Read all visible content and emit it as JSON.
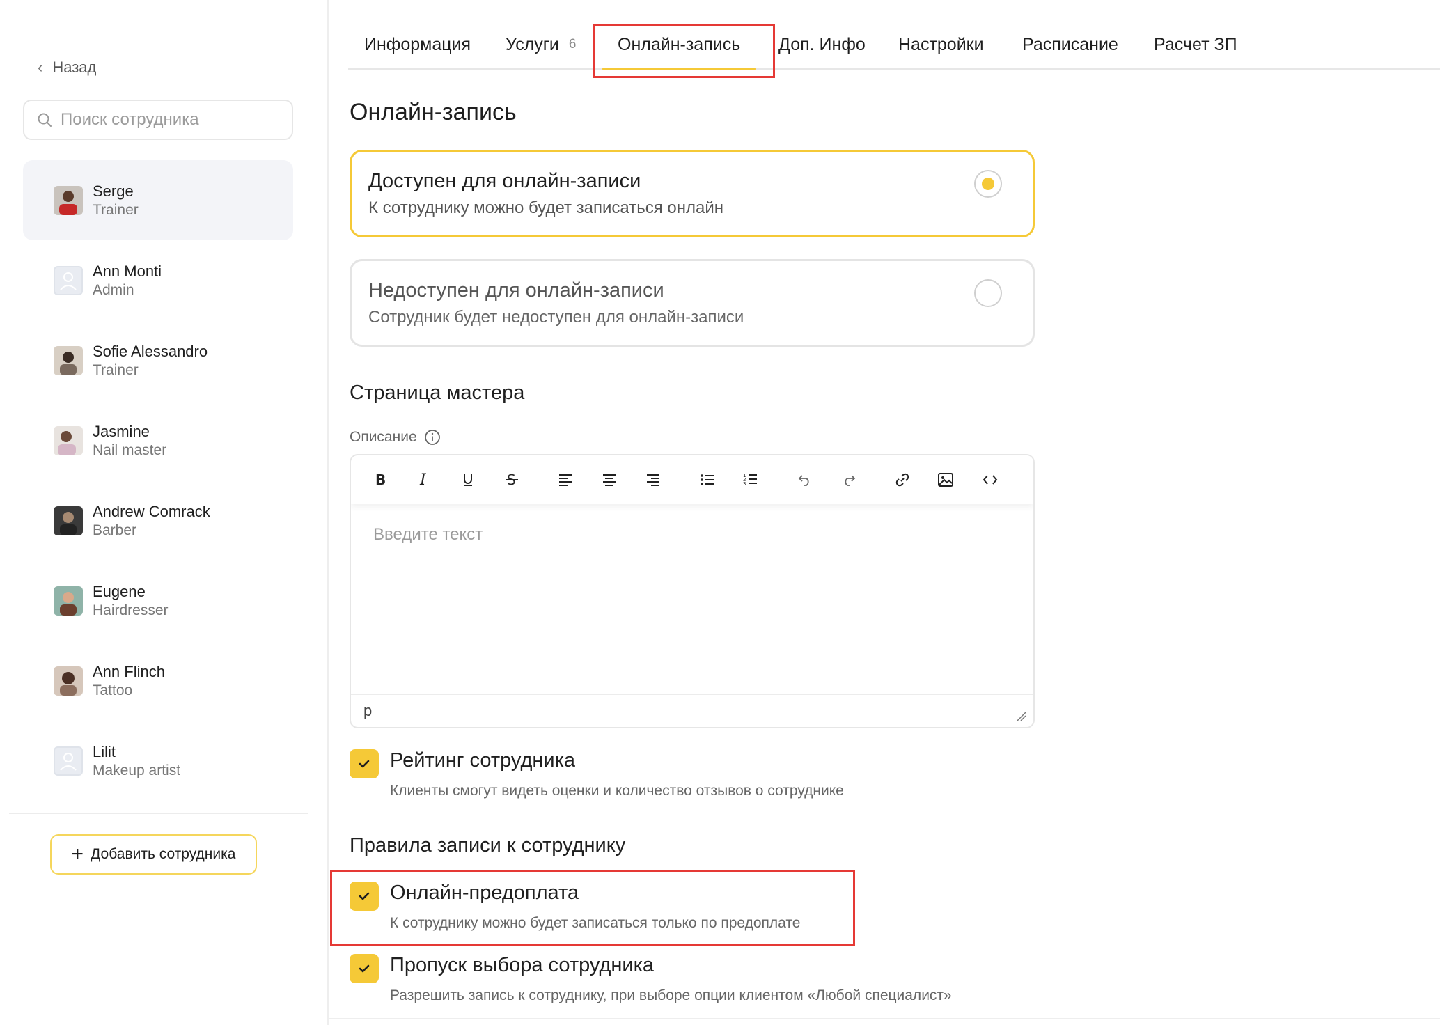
{
  "sidebar": {
    "back_label": "Назад",
    "search_placeholder": "Поиск сотрудника",
    "employees": [
      {
        "name": "Serge",
        "role": "Trainer",
        "avatar": "photo",
        "active": true
      },
      {
        "name": "Ann Monti",
        "role": "Admin",
        "avatar": "placeholder",
        "active": false
      },
      {
        "name": "Sofie Alessandro",
        "role": "Trainer",
        "avatar": "photo",
        "active": false
      },
      {
        "name": "Jasmine",
        "role": "Nail master",
        "avatar": "photo",
        "active": false
      },
      {
        "name": "Andrew Comrack",
        "role": "Barber",
        "avatar": "photo",
        "active": false
      },
      {
        "name": "Eugene",
        "role": "Hairdresser",
        "avatar": "photo",
        "active": false
      },
      {
        "name": "Ann Flinch",
        "role": "Tattoo",
        "avatar": "photo",
        "active": false
      },
      {
        "name": "Lilit",
        "role": "Makeup artist",
        "avatar": "placeholder",
        "active": false
      }
    ],
    "add_button_label": "Добавить сотрудника"
  },
  "tabs": [
    {
      "label": "Информация"
    },
    {
      "label": "Услуги",
      "count": "6"
    },
    {
      "label": "Онлайн-запись",
      "active": true
    },
    {
      "label": "Доп. Инфо"
    },
    {
      "label": "Настройки"
    },
    {
      "label": "Расписание"
    },
    {
      "label": "Расчет ЗП"
    }
  ],
  "online": {
    "title": "Онлайн-запись",
    "available": {
      "title": "Доступен для онлайн-записи",
      "subtitle": "К сотруднику можно будет записаться онлайн",
      "selected": true
    },
    "unavailable": {
      "title": "Недоступен для онлайн-записи",
      "subtitle": "Сотрудник будет недоступен для онлайн-записи",
      "selected": false
    }
  },
  "master_page": {
    "title": "Страница мастера",
    "description_label": "Описание",
    "editor_placeholder": "Введите текст",
    "editor_status": "p",
    "toolbar_icons": [
      "bold-icon",
      "italic-icon",
      "underline-icon",
      "strikethrough-icon",
      "align-left-icon",
      "align-center-icon",
      "align-right-icon",
      "bullet-list-icon",
      "numbered-list-icon",
      "undo-icon",
      "redo-icon",
      "link-icon",
      "image-icon",
      "code-icon"
    ]
  },
  "rating": {
    "title": "Рейтинг сотрудника",
    "subtitle": "Клиенты смогут видеть оценки и количество отзывов о сотруднике",
    "checked": true
  },
  "rules": {
    "title": "Правила записи к сотруднику",
    "prepay": {
      "title": "Онлайн-предоплата",
      "subtitle": "К сотруднику можно будет записаться только по предоплате",
      "checked": true
    },
    "skip": {
      "title": "Пропуск выбора сотрудника",
      "subtitle": "Разрешить запись к сотруднику, при выборе опции клиентом «Любой специалист»",
      "checked": true
    }
  },
  "colors": {
    "accent": "#f5c937",
    "highlight": "#e53935"
  }
}
